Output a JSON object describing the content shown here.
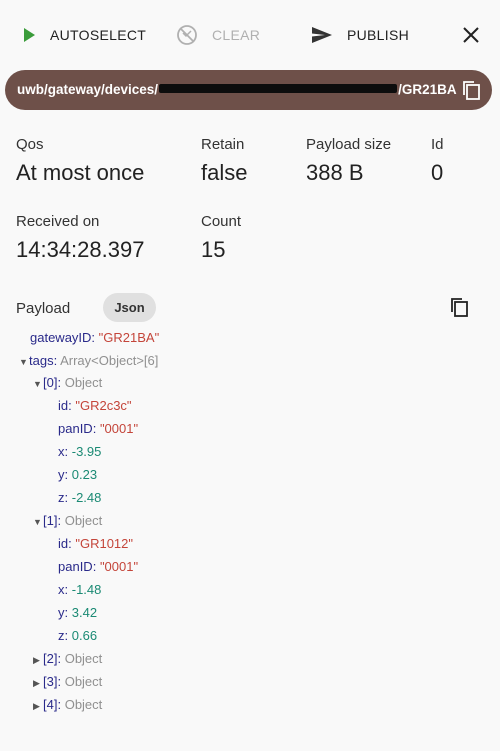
{
  "toolbar": {
    "autoselect_label": "AUTOSELECT",
    "clear_label": "CLEAR",
    "publish_label": "PUBLISH"
  },
  "colors": {
    "topic_bar": "#6e5049",
    "play_green": "#3b9c3b",
    "string_value": "#c4453a",
    "number_value": "#1b8a74"
  },
  "topic": {
    "prefix": "uwb/gateway/devices/",
    "suffix": "/GR21BA"
  },
  "fields": {
    "qos_label": "Qos",
    "qos_value": "At most once",
    "retain_label": "Retain",
    "retain_value": "false",
    "payload_size_label": "Payload size",
    "payload_size_value": "388 B",
    "id_label": "Id",
    "id_value": "0",
    "received_label": "Received on",
    "received_value": "14:34:28.397",
    "count_label": "Count",
    "count_value": "15"
  },
  "payload": {
    "label": "Payload",
    "format_chip": "Json",
    "tree": {
      "gateway_key": "gatewayID:",
      "gateway_val": "\"GR21BA\"",
      "tags_key": "tags:",
      "tags_meta": "Array<Object>[6]",
      "item0_key": "[0]:",
      "item0_meta": "Object",
      "item0_id_key": "id:",
      "item0_id_val": "\"GR2c3c\"",
      "item0_pan_key": "panID:",
      "item0_pan_val": "\"0001\"",
      "item0_x_key": "x:",
      "item0_x_val": "-3.95",
      "item0_y_key": "y:",
      "item0_y_val": "0.23",
      "item0_z_key": "z:",
      "item0_z_val": "-2.48",
      "item1_key": "[1]:",
      "item1_meta": "Object",
      "item1_id_key": "id:",
      "item1_id_val": "\"GR1012\"",
      "item1_pan_key": "panID:",
      "item1_pan_val": "\"0001\"",
      "item1_x_key": "x:",
      "item1_x_val": "-1.48",
      "item1_y_key": "y:",
      "item1_y_val": "3.42",
      "item1_z_key": "z:",
      "item1_z_val": "0.66",
      "item2_key": "[2]:",
      "item2_meta": "Object",
      "item3_key": "[3]:",
      "item3_meta": "Object",
      "item4_key": "[4]:",
      "item4_meta": "Object"
    }
  }
}
